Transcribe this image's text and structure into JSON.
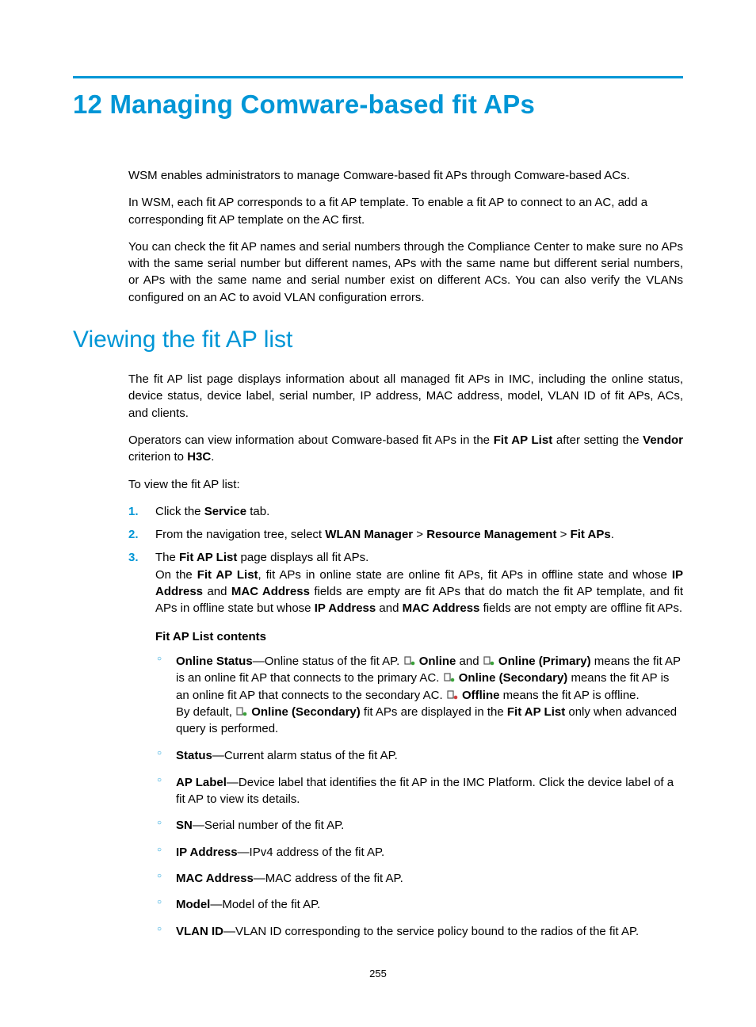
{
  "chapter_title": "12 Managing Comware-based fit APs",
  "intro": {
    "p1": "WSM enables administrators to manage Comware-based fit APs through Comware-based ACs.",
    "p2": "In WSM, each fit AP corresponds to a fit AP template. To enable a fit AP to connect to an AC, add a corresponding fit AP template on the AC first.",
    "p3": "You can check the fit AP names and serial numbers through the Compliance Center to make sure no APs with the same serial number but different names, APs with the same name but different serial numbers, or APs with the same name and serial number exist on different ACs. You can also verify the VLANs configured on an AC to avoid VLAN configuration errors."
  },
  "section_title": "Viewing the fit AP list",
  "view": {
    "p1": "The fit AP list page displays information about all managed fit APs in IMC, including the online status, device status, device label, serial number, IP address, MAC address, model, VLAN ID of fit APs, ACs, and clients.",
    "p2_a": "Operators can view information about Comware-based fit APs in the ",
    "p2_b": "Fit AP List",
    "p2_c": " after setting the ",
    "p2_d": "Vendor",
    "p2_e": " criterion to ",
    "p2_f": "H3C",
    "p2_g": ".",
    "p3": "To view the fit AP list:"
  },
  "steps": {
    "s1_num": "1.",
    "s1_a": "Click the ",
    "s1_b": "Service",
    "s1_c": " tab.",
    "s2_num": "2.",
    "s2_a": "From the navigation tree, select ",
    "s2_b": "WLAN Manager",
    "s2_sep1": " > ",
    "s2_c": "Resource Management",
    "s2_sep2": " > ",
    "s2_d": "Fit APs",
    "s2_e": ".",
    "s3_num": "3.",
    "s3_a": "The ",
    "s3_b": "Fit AP List",
    "s3_c": " page displays all fit APs.",
    "s3_p_a": "On the ",
    "s3_p_b": "Fit AP List",
    "s3_p_c": ", fit APs in online state are online fit APs, fit APs in offline state and whose ",
    "s3_p_d": "IP Address",
    "s3_p_e": " and ",
    "s3_p_f": "MAC Address",
    "s3_p_g": " fields are empty are fit APs that do match the fit AP template, and fit APs in offline state but whose ",
    "s3_p_h": "IP Address",
    "s3_p_i": " and ",
    "s3_p_j": "MAC Address",
    "s3_p_k": " fields are not empty are offline fit APs."
  },
  "contents_head": "Fit AP List contents",
  "bullets": {
    "b1_a": "Online Status",
    "b1_b": "—Online status of the fit AP. ",
    "b1_c": "Online",
    "b1_d": " and ",
    "b1_e": "Online (Primary)",
    "b1_f": " means the fit AP is an online fit AP that connects to the primary AC. ",
    "b1_g": "Online (Secondary)",
    "b1_h": " means the fit AP is an online fit AP that connects to the secondary AC. ",
    "b1_i": "Offline",
    "b1_j": " means the fit AP is offline.",
    "b1_k": "By default, ",
    "b1_l": "Online (Secondary)",
    "b1_m": " fit APs are displayed in the ",
    "b1_n": "Fit AP List",
    "b1_o": " only when advanced query is performed.",
    "b2_a": "Status",
    "b2_b": "—Current alarm status of the fit AP.",
    "b3_a": "AP Label",
    "b3_b": "—Device label that identifies the fit AP in the IMC Platform. Click the device label of a fit AP to view its details.",
    "b4_a": "SN",
    "b4_b": "—Serial number of the fit AP.",
    "b5_a": "IP Address",
    "b5_b": "—IPv4 address of the fit AP.",
    "b6_a": "MAC Address",
    "b6_b": "—MAC address of the fit AP.",
    "b7_a": "Model",
    "b7_b": "—Model of the fit AP.",
    "b8_a": "VLAN ID",
    "b8_b": "—VLAN ID corresponding to the service policy bound to the radios of the fit AP."
  },
  "page_number": "255",
  "icon_colors": {
    "online": "#3aa03a",
    "offline": "#d04040"
  }
}
